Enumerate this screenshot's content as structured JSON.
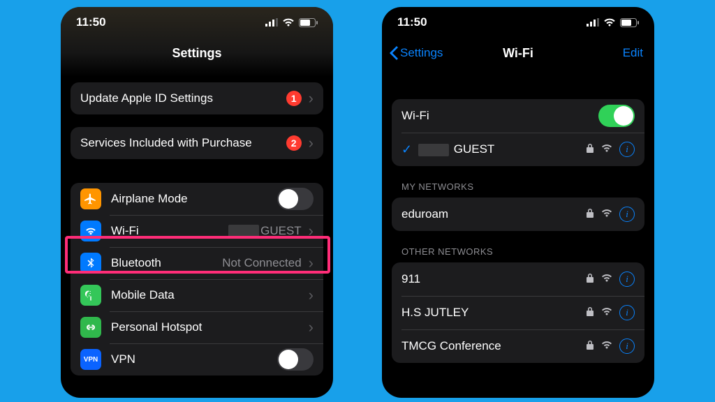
{
  "status": {
    "time": "11:50"
  },
  "left": {
    "title": "Settings",
    "row_apple_id": {
      "label": "Update Apple ID Settings",
      "badge": "1"
    },
    "row_services": {
      "label": "Services Included with Purchase",
      "badge": "2"
    },
    "row_airplane": {
      "label": "Airplane Mode"
    },
    "row_wifi": {
      "label": "Wi-Fi",
      "value": "GUEST"
    },
    "row_bt": {
      "label": "Bluetooth",
      "value": "Not Connected"
    },
    "row_mobile": {
      "label": "Mobile Data"
    },
    "row_hotspot": {
      "label": "Personal Hotspot"
    },
    "row_vpn": {
      "label": "VPN",
      "badge_text": "VPN"
    }
  },
  "right": {
    "back": "Settings",
    "title": "Wi-Fi",
    "edit": "Edit",
    "toggle_label": "Wi-Fi",
    "connected": "GUEST",
    "section_my": "MY NETWORKS",
    "section_other": "OTHER NETWORKS",
    "my_networks": [
      {
        "name": "eduroam"
      }
    ],
    "other_networks": [
      {
        "name": "911"
      },
      {
        "name": "H.S JUTLEY"
      },
      {
        "name": "TMCG Conference"
      }
    ]
  }
}
